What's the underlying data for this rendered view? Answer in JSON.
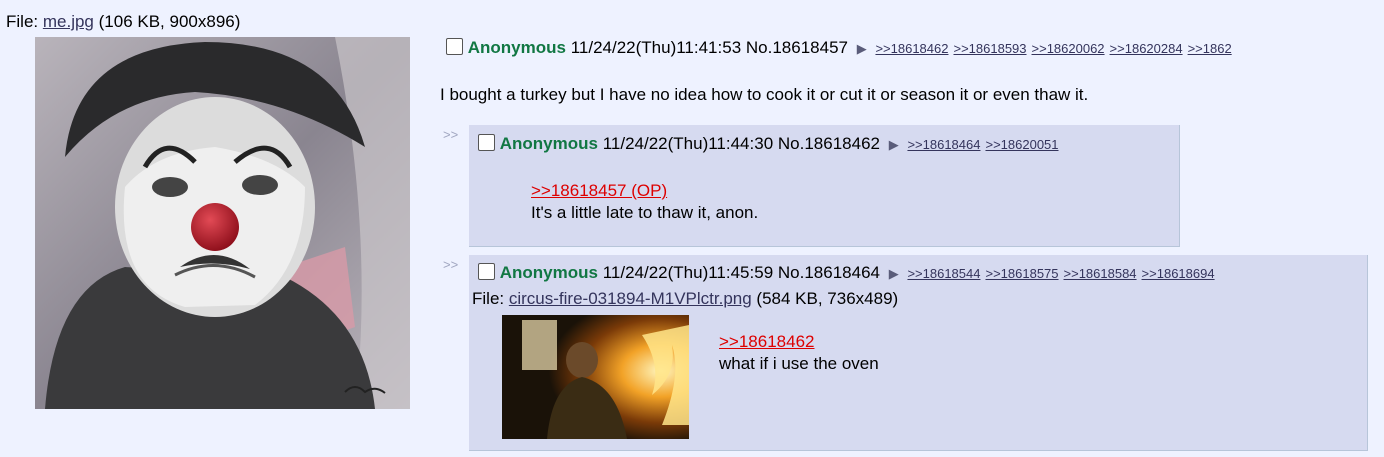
{
  "op": {
    "file_label": "File:",
    "file_name": "me.jpg",
    "file_meta": "(106 KB, 900x896)",
    "name": "Anonymous",
    "datetime": "11/24/22(Thu)11:41:53",
    "post_no": "No.18618457",
    "backlinks": [
      ">>18618462",
      ">>18618593",
      ">>18620062",
      ">>18620284",
      ">>1862"
    ],
    "comment": "I bought a turkey but I have no idea how to cook it or cut it or season it or even thaw it."
  },
  "replies": [
    {
      "side_arrows": ">>",
      "name": "Anonymous",
      "datetime": "11/24/22(Thu)11:44:30",
      "post_no": "No.18618462",
      "backlinks": [
        ">>18618464",
        ">>18620051"
      ],
      "quote": ">>18618457 (OP)",
      "comment": "It's a little late to thaw it, anon."
    },
    {
      "side_arrows": ">>",
      "name": "Anonymous",
      "datetime": "11/24/22(Thu)11:45:59",
      "post_no": "No.18618464",
      "backlinks": [
        ">>18618544",
        ">>18618575",
        ">>18618584",
        ">>18618694"
      ],
      "file_label": "File:",
      "file_name": "circus-fire-031894-M1VPlctr.png",
      "file_meta": "(584 KB, 736x489)",
      "quote": ">>18618462",
      "comment": "what if i use the oven"
    }
  ],
  "icons": [
    "post-menu-arrow-icon",
    "checkbox-icon"
  ]
}
